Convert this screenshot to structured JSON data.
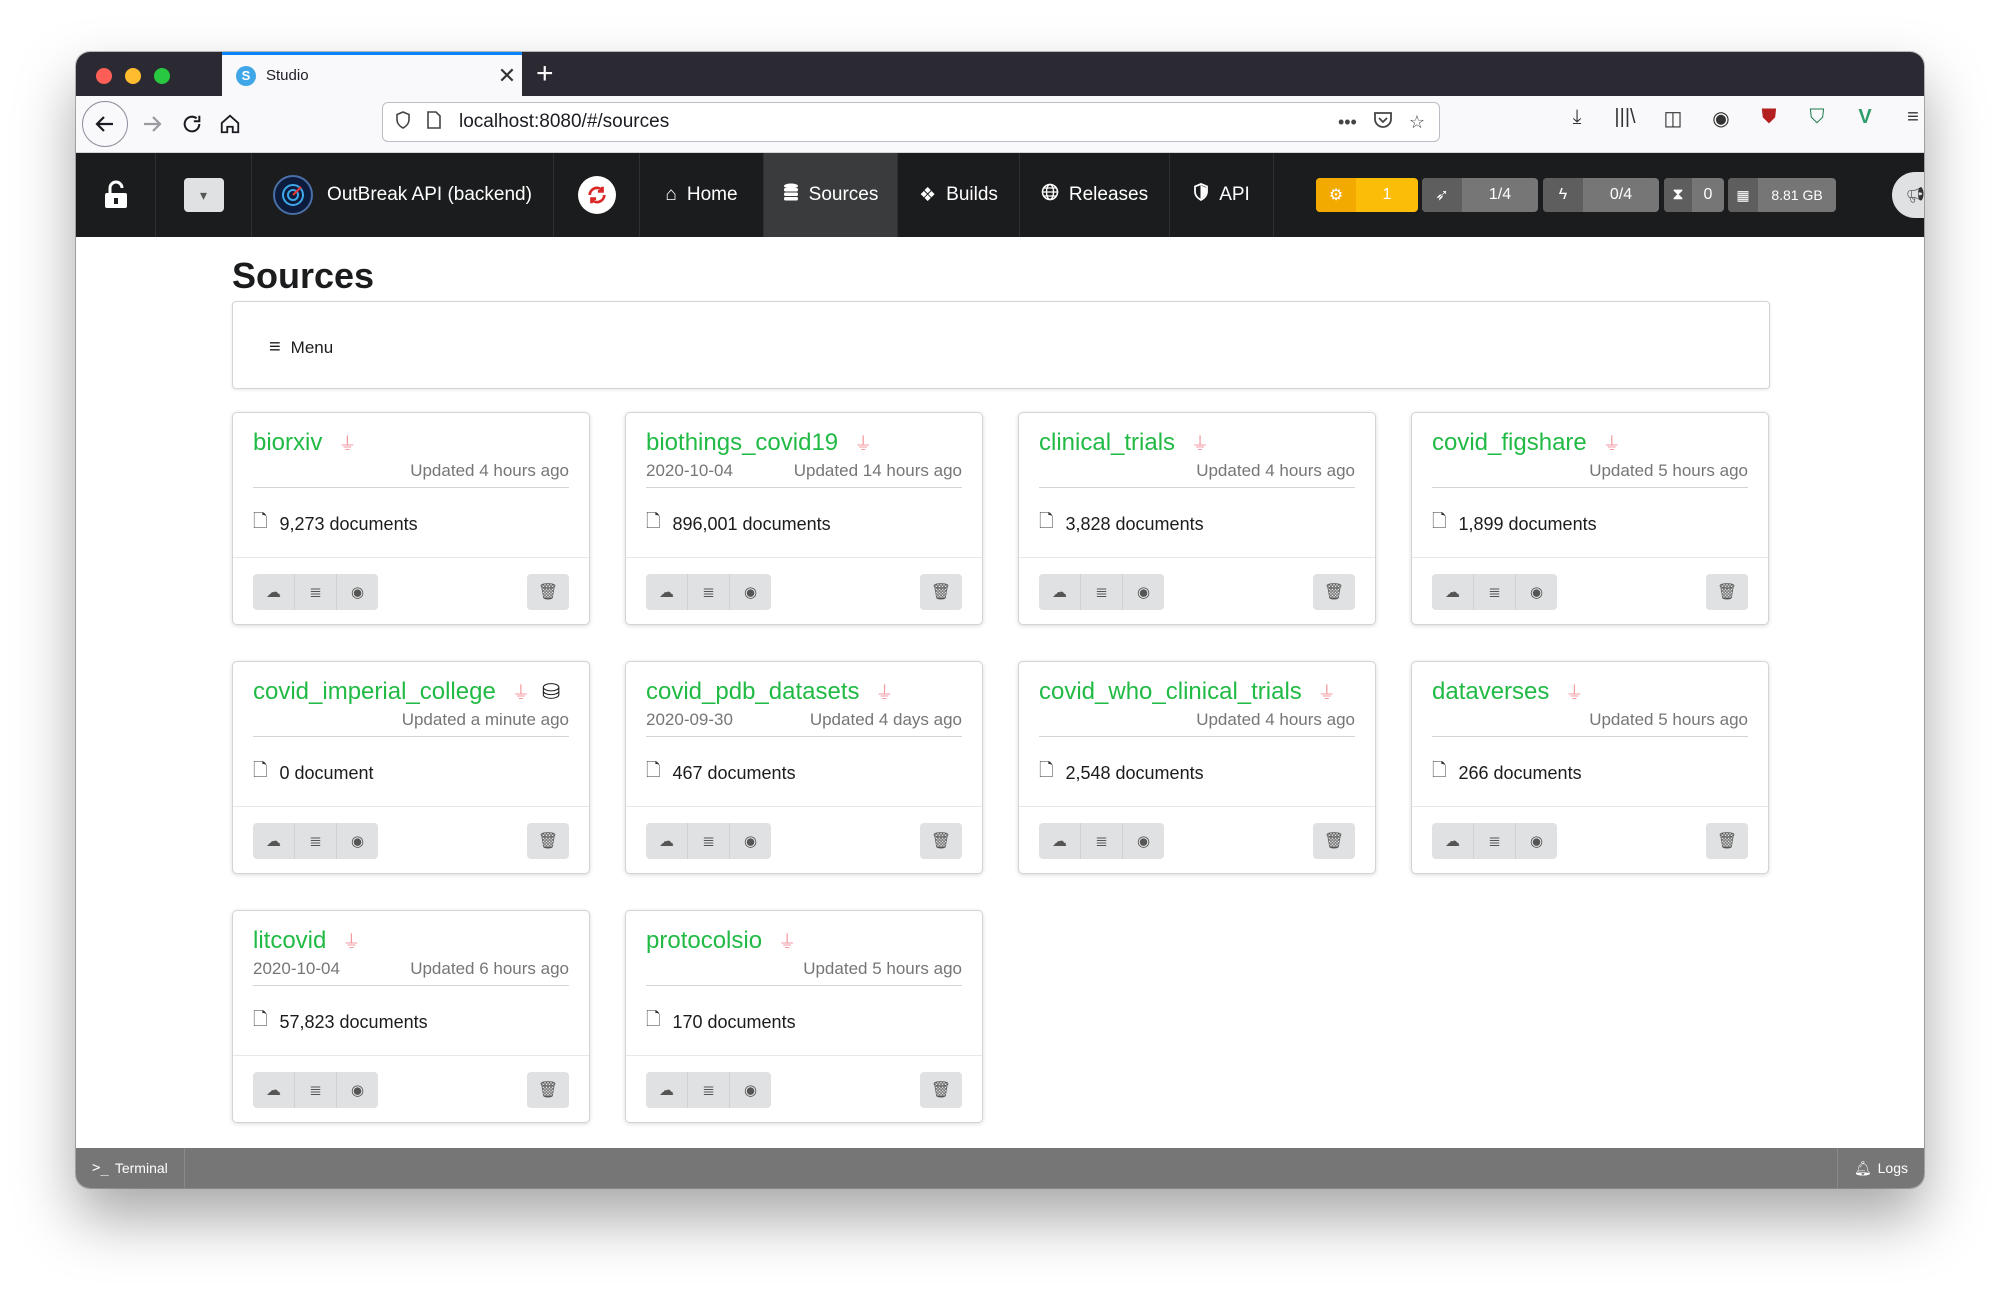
{
  "browser": {
    "tab_title": "Studio",
    "url": "localhost:8080/#/sources",
    "colors": {
      "close": "#ff5f57",
      "minimize": "#febc2e",
      "zoom": "#28c840",
      "tab_accent": "#0a84ff"
    }
  },
  "header": {
    "app_name": "OutBreak API (backend)",
    "nav": [
      {
        "label": "Home",
        "icon": "home-icon"
      },
      {
        "label": "Sources",
        "icon": "database-icon",
        "active": true
      },
      {
        "label": "Builds",
        "icon": "cubes-icon"
      },
      {
        "label": "Releases",
        "icon": "globe-icon"
      },
      {
        "label": "API",
        "icon": "shield-icon"
      }
    ],
    "stats": {
      "processes": "1",
      "jobs": "1/4",
      "threads": "0/4",
      "queued": "0",
      "memory": "8.81 GB",
      "notifications": "0"
    },
    "colors": {
      "bar": "#1b1c1d",
      "processes": "#fbbd08",
      "refresh": "#db2828"
    }
  },
  "page": {
    "title": "Sources",
    "menu_label": "Menu"
  },
  "sources": [
    {
      "name": "biorxiv",
      "date": "",
      "updated": "Updated 4 hours ago",
      "documents": "9,273 documents"
    },
    {
      "name": "biothings_covid19",
      "date": "2020-10-04",
      "updated": "Updated 14 hours ago",
      "documents": "896,001 documents"
    },
    {
      "name": "clinical_trials",
      "date": "",
      "updated": "Updated 4 hours ago",
      "documents": "3,828 documents"
    },
    {
      "name": "covid_figshare",
      "date": "",
      "updated": "Updated 5 hours ago",
      "documents": "1,899 documents"
    },
    {
      "name": "covid_imperial_college",
      "date": "",
      "updated": "Updated a minute ago",
      "documents": "0 document"
    },
    {
      "name": "covid_pdb_datasets",
      "date": "2020-09-30",
      "updated": "Updated 4 days ago",
      "documents": "467 documents"
    },
    {
      "name": "covid_who_clinical_trials",
      "date": "",
      "updated": "Updated 4 hours ago",
      "documents": "2,548 documents"
    },
    {
      "name": "dataverses",
      "date": "",
      "updated": "Updated 5 hours ago",
      "documents": "266 documents"
    },
    {
      "name": "litcovid",
      "date": "2020-10-04",
      "updated": "Updated 6 hours ago",
      "documents": "57,823 documents"
    },
    {
      "name": "protocolsio",
      "date": "",
      "updated": "Updated 5 hours ago",
      "documents": "170 documents"
    }
  ],
  "statusbar": {
    "terminal": "Terminal",
    "logs": "Logs"
  },
  "theme": {
    "source_name": "#21ba45",
    "plug": "#f29aa0",
    "status_bar": "#767676"
  }
}
